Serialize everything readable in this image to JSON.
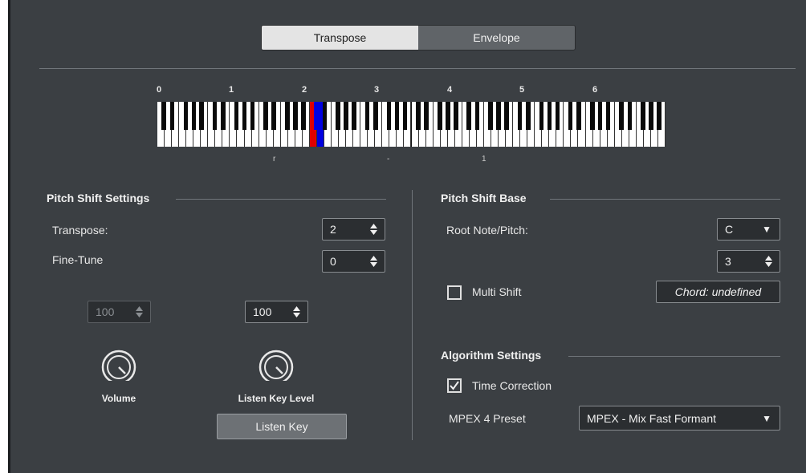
{
  "tabs": [
    {
      "label": "Transpose",
      "active": true
    },
    {
      "label": "Envelope",
      "active": false
    }
  ],
  "keyboard": {
    "octave_numbers": [
      "0",
      "1",
      "2",
      "3",
      "4",
      "5",
      "6"
    ],
    "root_key_color": "#e00000",
    "target_key_color": "#0000e0",
    "tick_marks": [
      "r",
      "-",
      "1"
    ]
  },
  "pitch_shift_settings": {
    "title": "Pitch Shift Settings",
    "transpose_label": "Transpose:",
    "transpose_value": "2",
    "fine_tune_label": "Fine-Tune",
    "fine_tune_value": "0",
    "volume_value": "100",
    "listen_key_level_value": "100",
    "volume_label": "Volume",
    "listen_key_level_label": "Listen Key Level",
    "listen_key_button": "Listen Key"
  },
  "pitch_shift_base": {
    "title": "Pitch Shift Base",
    "root_note_label": "Root Note/Pitch:",
    "root_note_value": "C",
    "octave_value": "3",
    "multi_shift_label": "Multi Shift",
    "multi_shift_checked": false,
    "chord_value": "Chord: undefined"
  },
  "algorithm_settings": {
    "title": "Algorithm Settings",
    "time_correction_label": "Time Correction",
    "time_correction_checked": true,
    "preset_label": "MPEX 4 Preset",
    "preset_value": "MPEX - Mix Fast Formant"
  },
  "icons": {
    "spin_arrows": "up-down-arrows-icon",
    "dropdown": "triangle-down-icon",
    "check": "check-icon",
    "knob": "knob-icon"
  }
}
